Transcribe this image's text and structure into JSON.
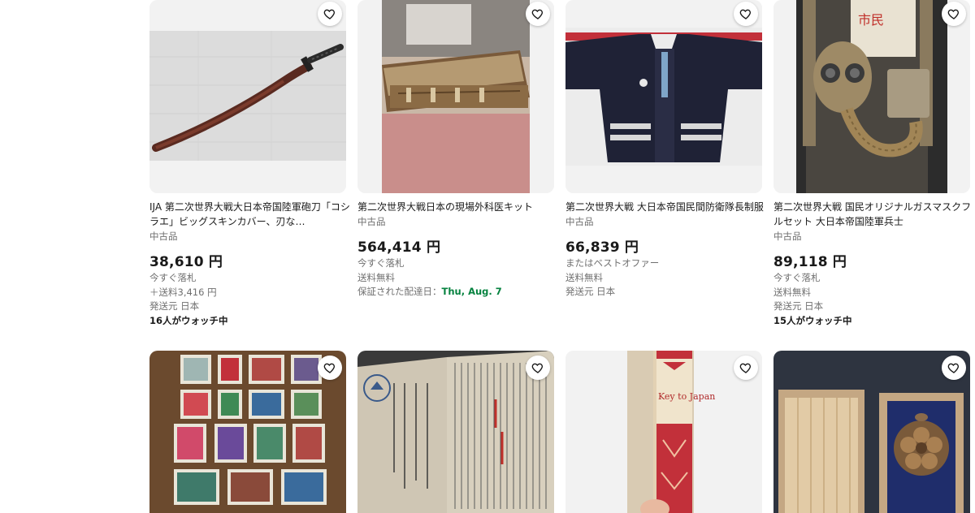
{
  "listings_row1": [
    {
      "title": "IJA 第二次世界大戦大日本帝国陸軍砲刀「コシラエ」ビッグスキンカバー、刃な…",
      "condition": "中古品",
      "price": "38,610 円",
      "buy_format": "今すぐ落札",
      "shipping": "＋送料3,416 円",
      "location": "発送元 日本",
      "watchers": "16人がウォッチ中"
    },
    {
      "title": "第二次世界大戦日本の現場外科医キット",
      "condition": "中古品",
      "price": "564,414 円",
      "buy_format": "今すぐ落札",
      "shipping": "送料無料",
      "delivery_prefix": "保証された配達日：",
      "delivery_date": "Thu, Aug. 7"
    },
    {
      "title": "第二次世界大戦 大日本帝国民間防衛隊長制服",
      "condition": "中古品",
      "price": "66,839 円",
      "buy_format": "またはベストオファー",
      "shipping": "送料無料",
      "location": "発送元 日本"
    },
    {
      "title": "第二次世界大戦 国民オリジナルガスマスクフルセット 大日本帝国陸軍兵士",
      "condition": "中古品",
      "price": "89,118 円",
      "buy_format": "今すぐ落札",
      "shipping": "送料無料",
      "location": "発送元 日本",
      "watchers": "15人がウォッチ中"
    }
  ],
  "photo_text": {
    "book_spine": "Key to Japan"
  },
  "icons": {
    "watch": "heart-icon"
  },
  "colors": {
    "delivery_green": "#05823f",
    "muted_text": "#707070",
    "card_bg": "#f2f2f2"
  }
}
